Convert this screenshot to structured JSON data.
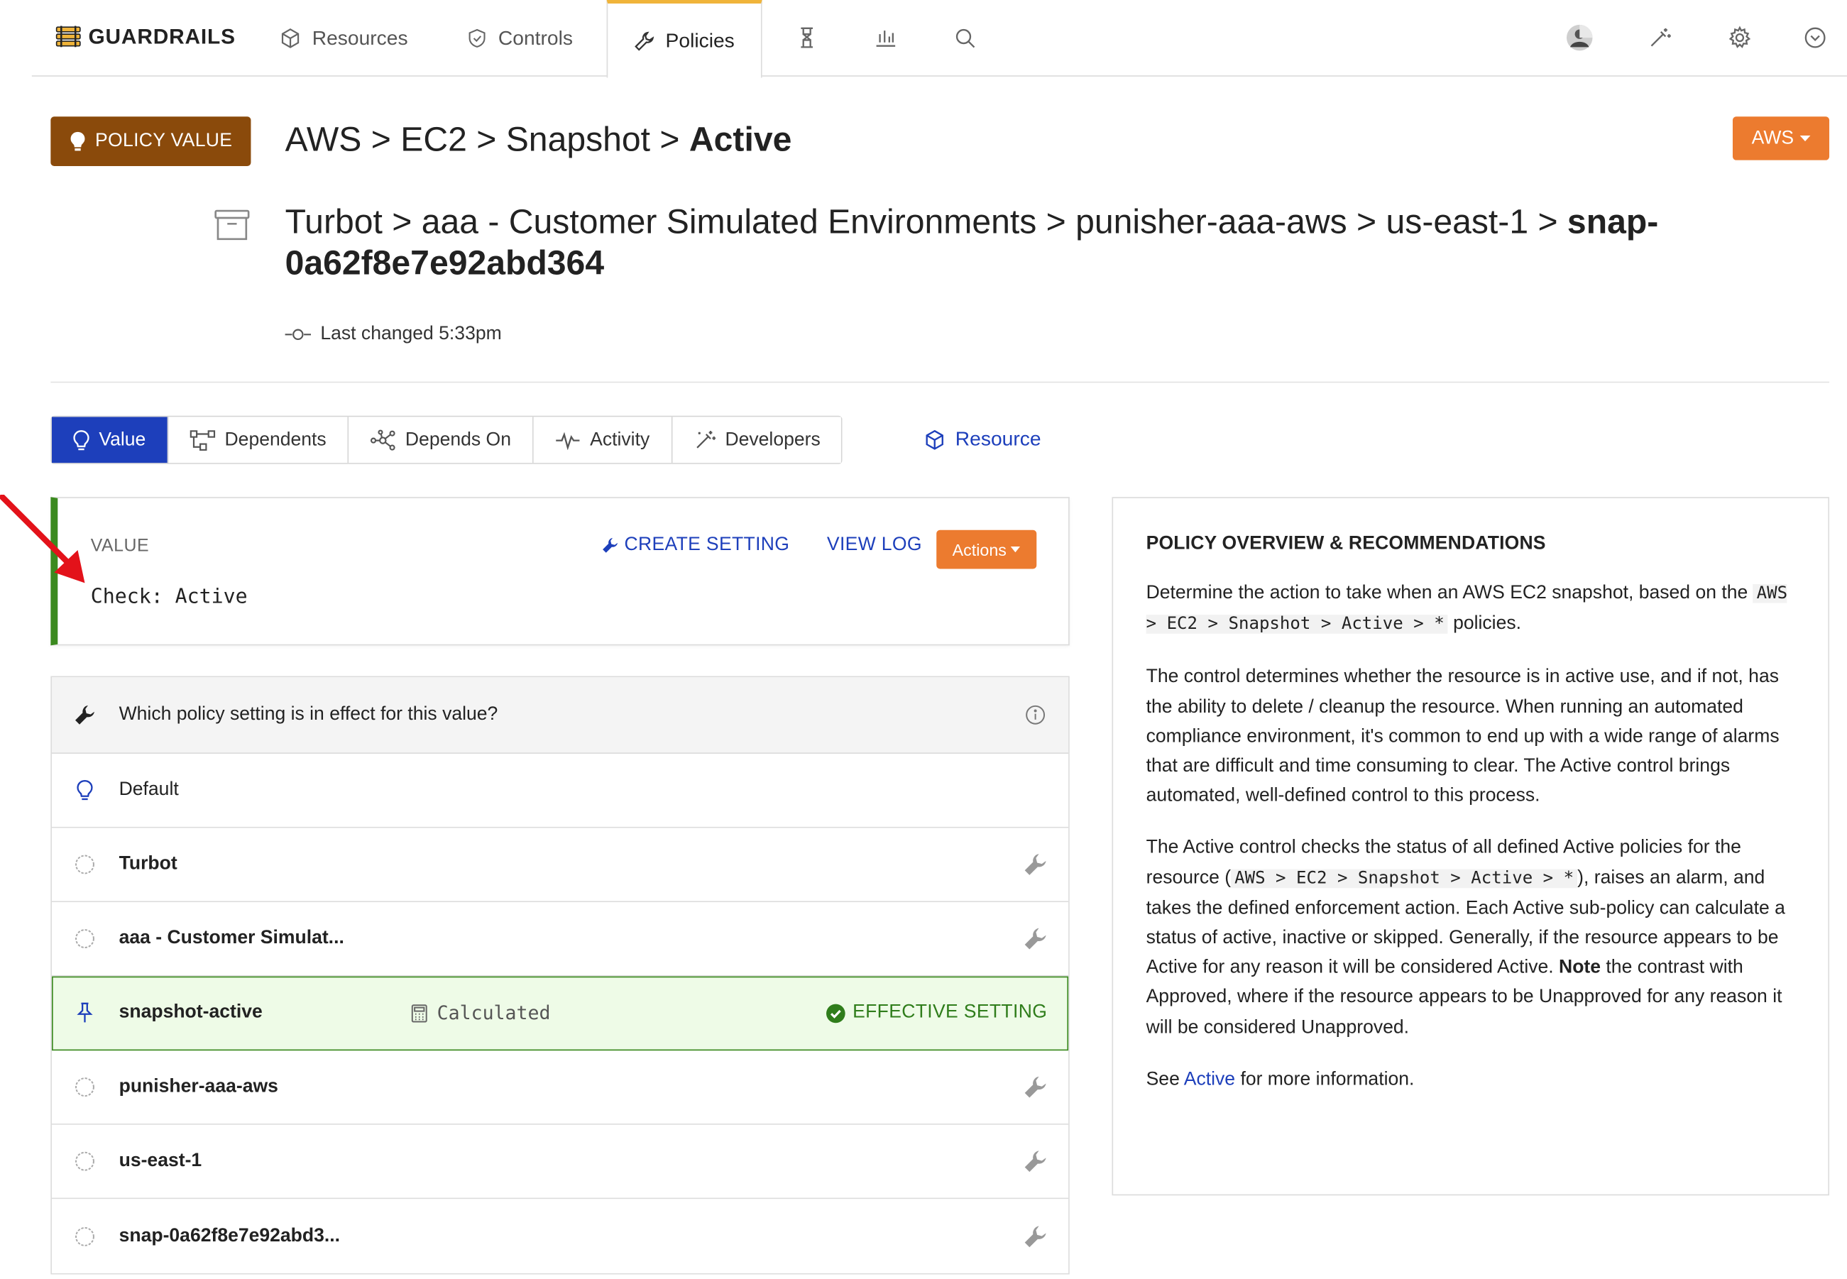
{
  "brand": {
    "name": "GUARDRAILS"
  },
  "nav": {
    "items": [
      {
        "label": "Resources",
        "icon": "cube-icon"
      },
      {
        "label": "Controls",
        "icon": "shield-icon"
      },
      {
        "label": "Policies",
        "icon": "wrench-icon",
        "active": true
      }
    ],
    "icons": [
      "flask-icon",
      "bar-chart-icon",
      "search-icon",
      "avatar",
      "magic-wand-icon",
      "gear-icon",
      "chevron-circle-icon"
    ]
  },
  "header": {
    "badge": "POLICY VALUE",
    "policy_path": "AWS > EC2 > Snapshot > ",
    "policy_name": "Active",
    "resource_path": "Turbot > aaa - Customer Simulated Environments > punisher-aaa-aws > us-east-1 > ",
    "resource_name": "snap-0a62f8e7e92abd364",
    "last_changed": "Last changed 5:33pm",
    "aws_button": "AWS"
  },
  "tabs": [
    {
      "label": "Value",
      "icon": "lightbulb-icon",
      "active": true
    },
    {
      "label": "Dependents",
      "icon": "tree-icon"
    },
    {
      "label": "Depends On",
      "icon": "network-icon"
    },
    {
      "label": "Activity",
      "icon": "pulse-icon"
    },
    {
      "label": "Developers",
      "icon": "magic-wand-icon"
    }
  ],
  "resource_link": "Resource",
  "value_card": {
    "label": "VALUE",
    "value": "Check: Active",
    "create_setting": "CREATE SETTING",
    "view_log": "VIEW LOG",
    "actions": "Actions"
  },
  "settings": {
    "question": "Which policy setting is in effect for this value?",
    "rows": [
      {
        "label": "Default",
        "bold": false
      },
      {
        "label": "Turbot",
        "bold": true
      },
      {
        "label": "aaa - Customer Simulat...",
        "bold": true
      },
      {
        "label": "snapshot-active",
        "bold": true,
        "calc": "Calculated",
        "effective": "EFFECTIVE SETTING"
      },
      {
        "label": "punisher-aaa-aws",
        "bold": true
      },
      {
        "label": "us-east-1",
        "bold": true
      },
      {
        "label": "snap-0a62f8e7e92abd3...",
        "bold": true
      }
    ]
  },
  "overview": {
    "title": "POLICY OVERVIEW & RECOMMENDATIONS",
    "p1_a": "Determine the action to take when an AWS EC2 snapshot, based on the ",
    "p1_code": "AWS > EC2 > Snapshot > Active > *",
    "p1_b": " policies.",
    "p2": "The control determines whether the resource is in active use, and if not, has the ability to delete / cleanup the resource. When running an automated compliance environment, it's common to end up with a wide range of alarms that are difficult and time consuming to clear. The Active control brings automated, well-defined control to this process.",
    "p3_a": "The Active control checks the status of all defined Active policies for the resource (",
    "p3_code": "AWS > EC2 > Snapshot > Active > *",
    "p3_b": "), raises an alarm, and takes the defined enforcement action. Each Active sub-policy can calculate a status of active, inactive or skipped. Generally, if the resource appears to be Active for any reason it will be considered Active. ",
    "p3_note": "Note",
    "p3_c": " the contrast with Approved, where if the resource appears to be Unapproved for any reason it will be considered Unapproved.",
    "p4_a": "See ",
    "p4_link": "Active",
    "p4_b": " for more information."
  },
  "colors": {
    "brand_brown": "#8a4a0b",
    "orange": "#ec7b2f",
    "blue": "#1d3fbb",
    "green": "#3b8a1f",
    "nav_accent": "#f0b43a"
  }
}
